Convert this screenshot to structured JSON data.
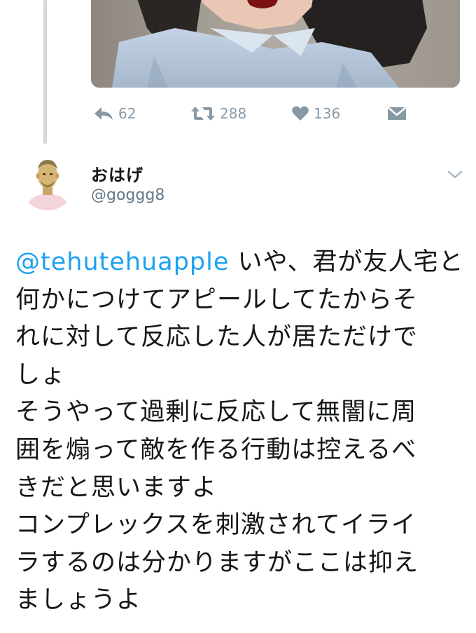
{
  "previous_tweet": {
    "media": {
      "alt": "",
      "icon": "photo"
    },
    "actions": {
      "reply": {
        "icon": "reply-icon",
        "count": "62"
      },
      "retweet": {
        "icon": "retweet-icon",
        "count": "288"
      },
      "like": {
        "icon": "heart-icon",
        "count": "136"
      },
      "message": {
        "icon": "envelope-icon"
      }
    }
  },
  "tweet": {
    "author": {
      "display_name": "おはげ",
      "username": "@goggg8"
    },
    "menu_icon": "chevron-down-icon",
    "mention": "@tehutehuapple",
    "lines": [
      " いや、君が友人宅と",
      "何かにつけてアピールしてたからそ",
      "れに対して反応した人が居ただけで",
      "しょ",
      "そうやって過剰に反応して無闇に周",
      "囲を煽って敵を作る行動は控えるべ",
      "きだと思いますよ",
      "コンプレックスを刺激されてイライ",
      "ラするのは分かりますがここは抑え",
      "ましょうよ"
    ]
  },
  "colors": {
    "text_primary": "#14171a",
    "text_secondary": "#657786",
    "icon_gray": "#8899a6",
    "link_blue": "#1da1f2",
    "thread_line": "#cfd9de"
  }
}
